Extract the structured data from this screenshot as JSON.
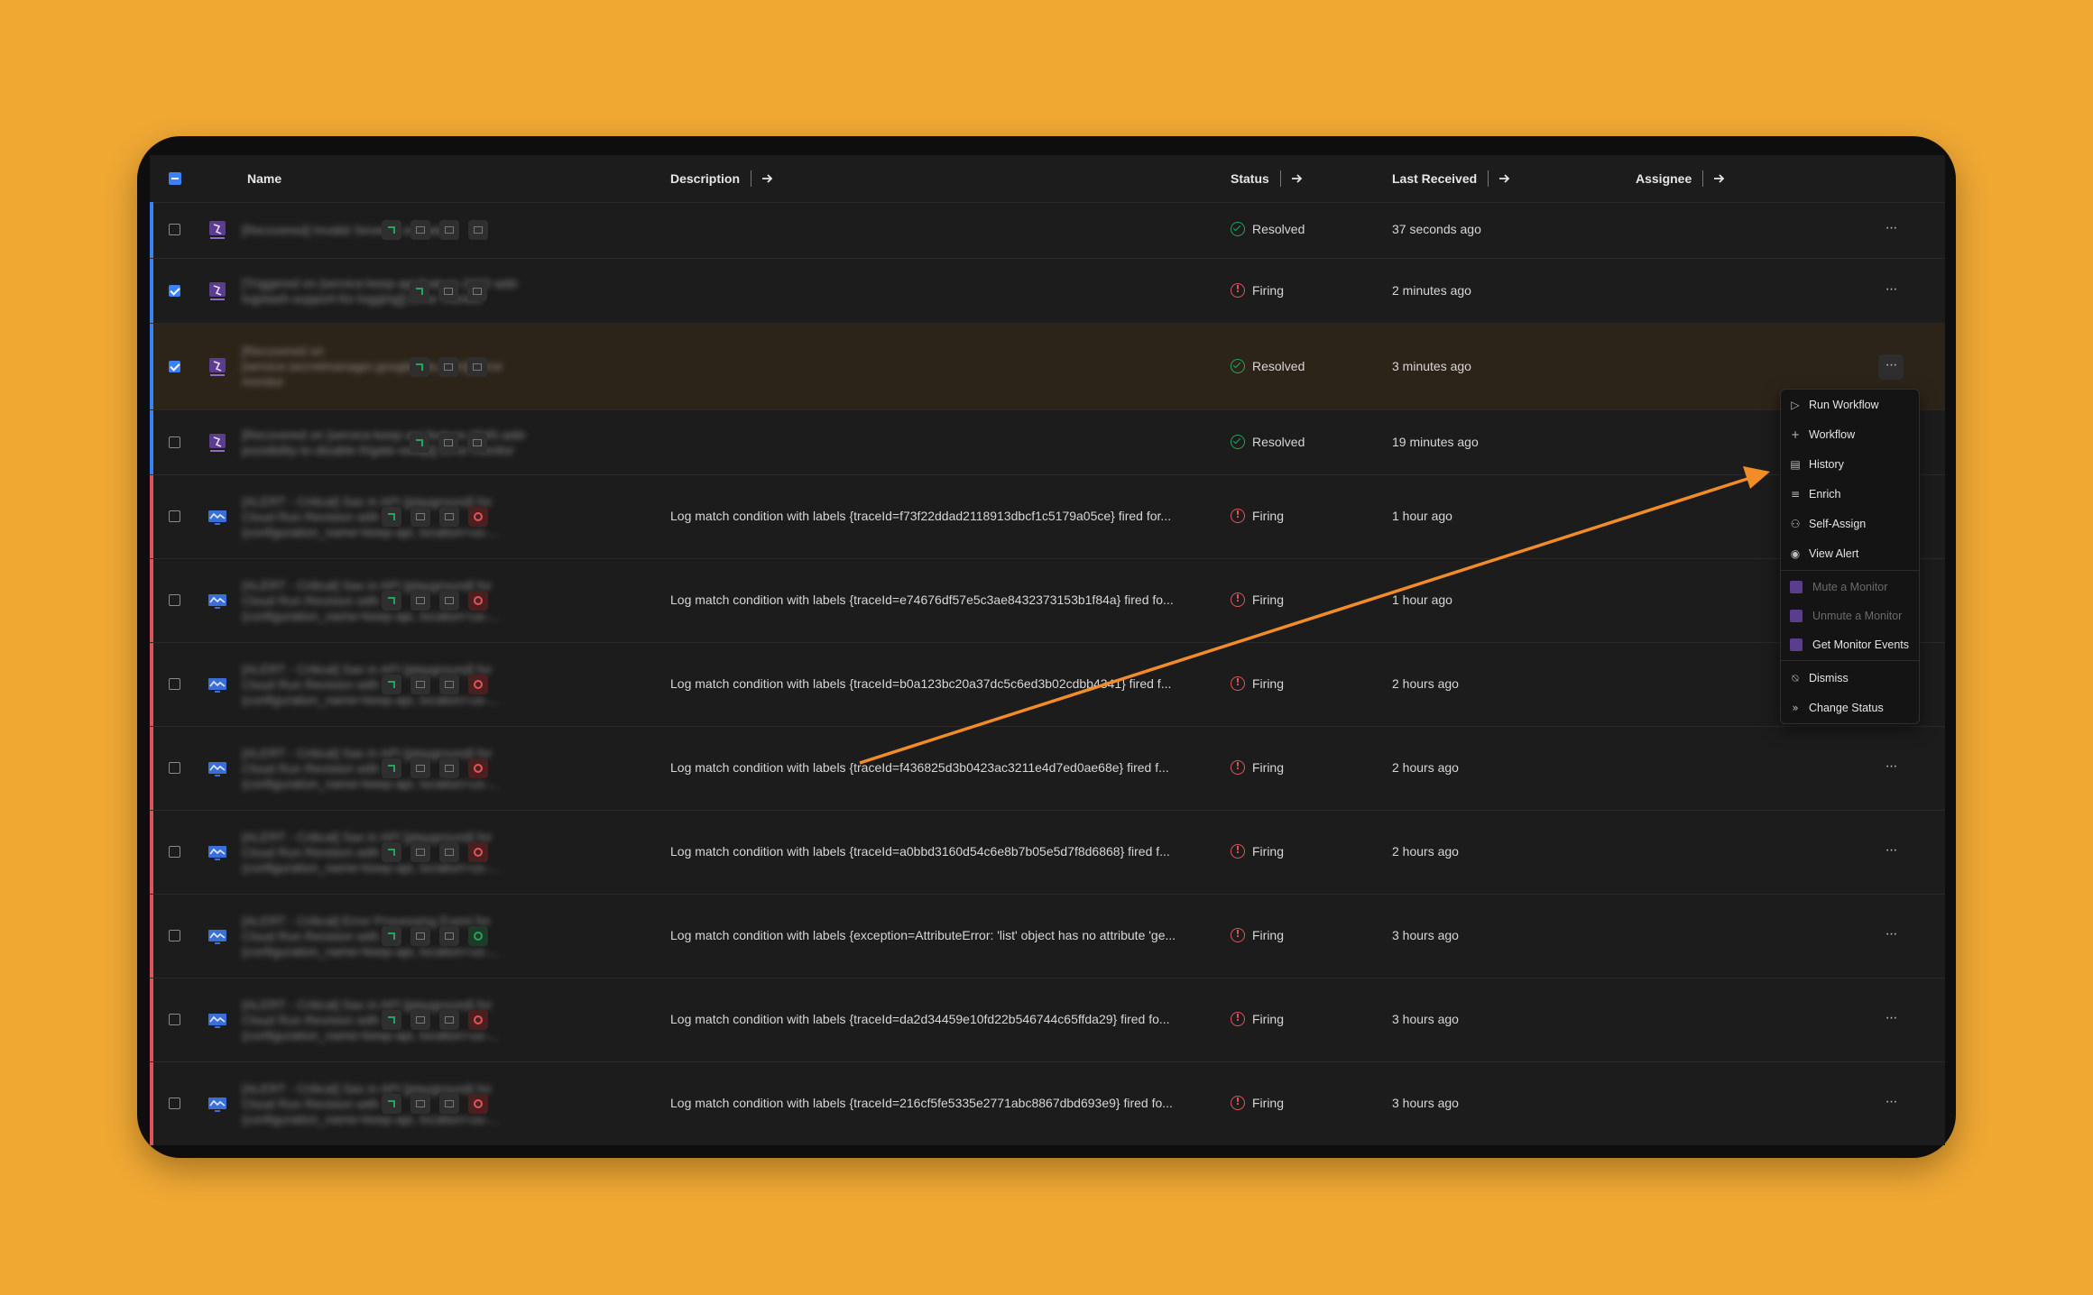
{
  "table": {
    "headers": {
      "name": "Name",
      "description": "Description",
      "status": "Status",
      "last_received": "Last Received",
      "assignee": "Assignee"
    }
  },
  "rows": [
    {
      "name": [
        "[Recovered] Invalid Severity or Status"
      ],
      "description": "",
      "status": "Resolved",
      "received": "37 seconds ago"
    },
    {
      "name": [
        "[Triggered on [service:keep-api feature-2022-add-",
        "logstash-support-for-logging]] Error monitor"
      ],
      "description": "",
      "status": "Firing",
      "received": "2 minutes ago"
    },
    {
      "name": [
        "[Recovered on",
        "[service:secretmanager.googleapis.com]] Error",
        "monitor"
      ],
      "description": "",
      "status": "Resolved",
      "received": "3 minutes ago"
    },
    {
      "name": [
        "[Recovered on [service:keep-api feature-2045-add-",
        "possibility-to-disable-frigate-setup]] Error monitor"
      ],
      "description": "",
      "status": "Resolved",
      "received": "19 minutes ago"
    },
    {
      "name": [
        "[ALERT - Critical] Sax in API [playground] for",
        "Cloud Run Revision with",
        "{configuration_name=keep-api, location=us-..."
      ],
      "description": "Log match condition with labels {traceId=f73f22ddad2118913dbcf1c5179a05ce} fired for...",
      "status": "Firing",
      "received": "1 hour ago"
    },
    {
      "name": [
        "[ALERT - Critical] Sax in API [playground] for",
        "Cloud Run Revision with",
        "{configuration_name=keep-api, location=us-..."
      ],
      "description": "Log match condition with labels {traceId=e74676df57e5c3ae8432373153b1f84a} fired fo...",
      "status": "Firing",
      "received": "1 hour ago"
    },
    {
      "name": [
        "[ALERT - Critical] Sax in API [playground] for",
        "Cloud Run Revision with",
        "{configuration_name=keep-api, location=us-..."
      ],
      "description": "Log match condition with labels {traceId=b0a123bc20a37dc5c6ed3b02cdbb4341} fired f...",
      "status": "Firing",
      "received": "2 hours ago"
    },
    {
      "name": [
        "[ALERT - Critical] Sax in API [playground] for",
        "Cloud Run Revision with",
        "{configuration_name=keep-api, location=us-..."
      ],
      "description": "Log match condition with labels {traceId=f436825d3b0423ac3211e4d7ed0ae68e} fired f...",
      "status": "Firing",
      "received": "2 hours ago"
    },
    {
      "name": [
        "[ALERT - Critical] Sax in API [playground] for",
        "Cloud Run Revision with",
        "{configuration_name=keep-api, location=us-..."
      ],
      "description": "Log match condition with labels {traceId=a0bbd3160d54c6e8b7b05e5d7f8d6868} fired f...",
      "status": "Firing",
      "received": "2 hours ago"
    },
    {
      "name": [
        "[ALERT - Critical] Error Processing Event for",
        "Cloud Run Revision with",
        "{configuration_name=keep-api, location=us-..."
      ],
      "description": "Log match condition with labels {exception=AttributeError: 'list' object has no attribute 'ge...",
      "status": "Firing",
      "received": "3 hours ago"
    },
    {
      "name": [
        "[ALERT - Critical] Sax in API [playground] for",
        "Cloud Run Revision with",
        "{configuration_name=keep-api, location=us-..."
      ],
      "description": "Log match condition with labels {traceId=da2d34459e10fd22b546744c65ffda29} fired fo...",
      "status": "Firing",
      "received": "3 hours ago"
    },
    {
      "name": [
        "[ALERT - Critical] Sax in API [playground] for",
        "Cloud Run Revision with",
        "{configuration_name=keep-api, location=us-..."
      ],
      "description": "Log match condition with labels {traceId=216cf5fe5335e2771abc8867dbd693e9} fired fo...",
      "status": "Firing",
      "received": "3 hours ago"
    }
  ],
  "more_label": "···",
  "menu": {
    "items": [
      {
        "label": "Run Workflow",
        "icon": "play-icon"
      },
      {
        "label": "Workflow",
        "icon": "plus-icon"
      },
      {
        "label": "History",
        "icon": "archive-icon"
      },
      {
        "label": "Enrich",
        "icon": "lines-icon"
      },
      {
        "label": "Self-Assign",
        "icon": "user-plus-icon"
      },
      {
        "label": "View Alert",
        "icon": "eye-icon"
      },
      {
        "label": "Mute a Monitor",
        "icon": "datadog-icon"
      },
      {
        "label": "Unmute a Monitor",
        "icon": "datadog-icon"
      },
      {
        "label": "Get Monitor Events",
        "icon": "datadog-icon"
      },
      {
        "label": "Dismiss",
        "icon": "bell-off-icon"
      },
      {
        "label": "Change Status",
        "icon": "double-chevron-right-icon"
      }
    ]
  },
  "colors": {
    "background": "#F0A833",
    "panel": "#1c1c1c",
    "selected_row": "#2d2419",
    "stripe_blue": "#3b82f6",
    "stripe_red": "#e0555b",
    "resolved": "#22a55a",
    "firing": "#e0555b",
    "annotation_arrow": "#F28C28"
  }
}
